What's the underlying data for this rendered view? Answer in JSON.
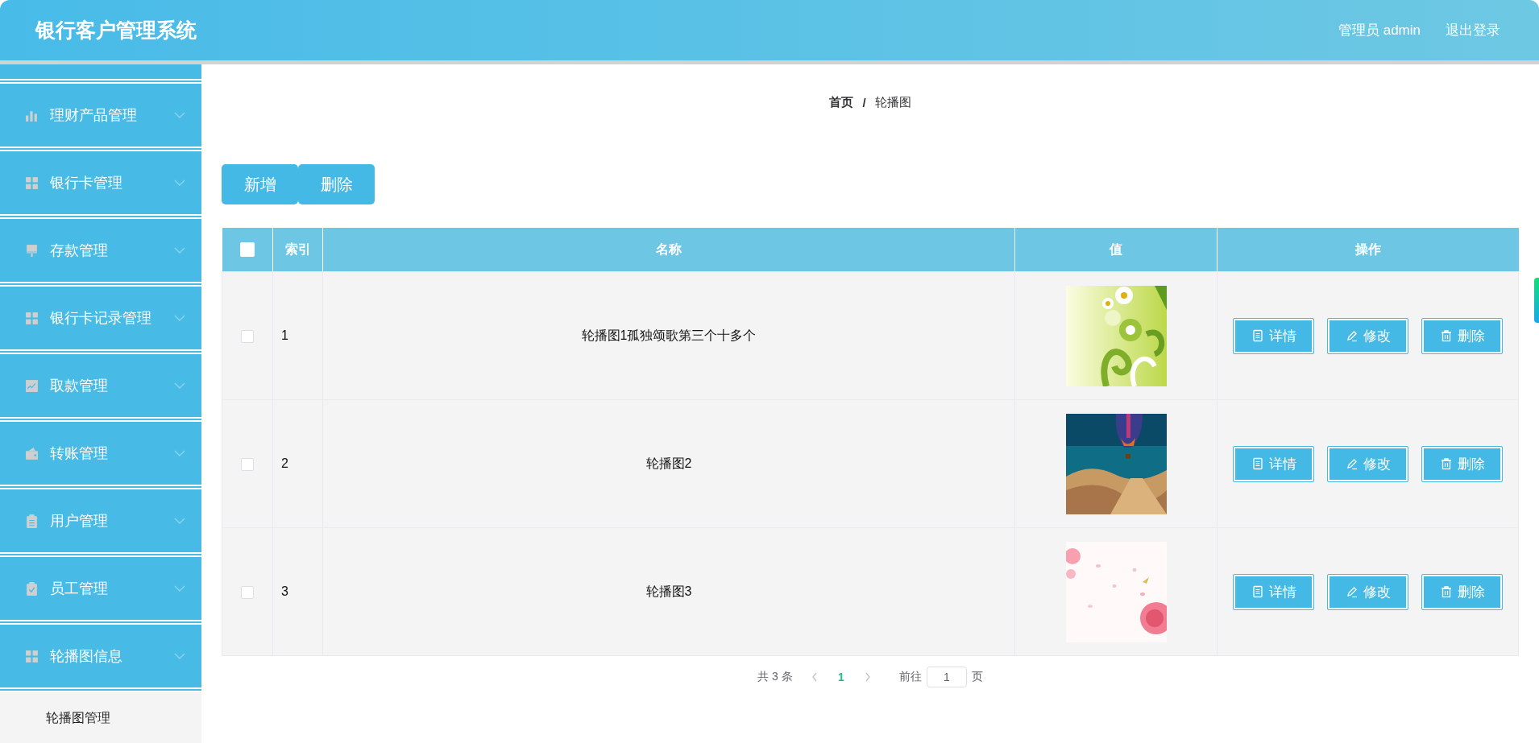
{
  "header": {
    "title": "银行客户管理系统",
    "user": "管理员 admin",
    "logout": "退出登录"
  },
  "sidebar": {
    "items": [
      {
        "label": "理财产品管理"
      },
      {
        "label": "银行卡管理"
      },
      {
        "label": "存款管理"
      },
      {
        "label": "银行卡记录管理"
      },
      {
        "label": "取款管理"
      },
      {
        "label": "转账管理"
      },
      {
        "label": "用户管理"
      },
      {
        "label": "员工管理"
      },
      {
        "label": "轮播图信息",
        "children": [
          {
            "label": "轮播图管理",
            "selected": true
          }
        ]
      }
    ]
  },
  "breadcrumb": {
    "items": [
      "首页",
      "轮播图"
    ],
    "separator": "/"
  },
  "toolbar": [
    "新增",
    "删除"
  ],
  "table": {
    "header_checked": false,
    "columns": [
      "索引",
      "名称",
      "值",
      "操作"
    ],
    "rows": [
      {
        "checked": false,
        "index": "1",
        "name": "轮播图1孤独颂歌第三个十多个",
        "value": {
          "kind": "picture"
        },
        "actions": [
          "详情",
          "修改",
          "删除"
        ]
      },
      {
        "checked": false,
        "index": "2",
        "name": "轮播图2",
        "value": {
          "kind": "picture"
        },
        "actions": [
          "详情",
          "修改",
          "删除"
        ]
      },
      {
        "checked": false,
        "index": "3",
        "name": "轮播图3",
        "value": {
          "kind": "picture"
        },
        "actions": [
          "详情",
          "修改",
          "删除"
        ]
      }
    ]
  },
  "pagination": {
    "total": "共 3 条",
    "pages": [
      {
        "label": "1",
        "selected": true
      }
    ],
    "goto_label": "前往",
    "goto_value": "1",
    "page_suffix": "页"
  }
}
